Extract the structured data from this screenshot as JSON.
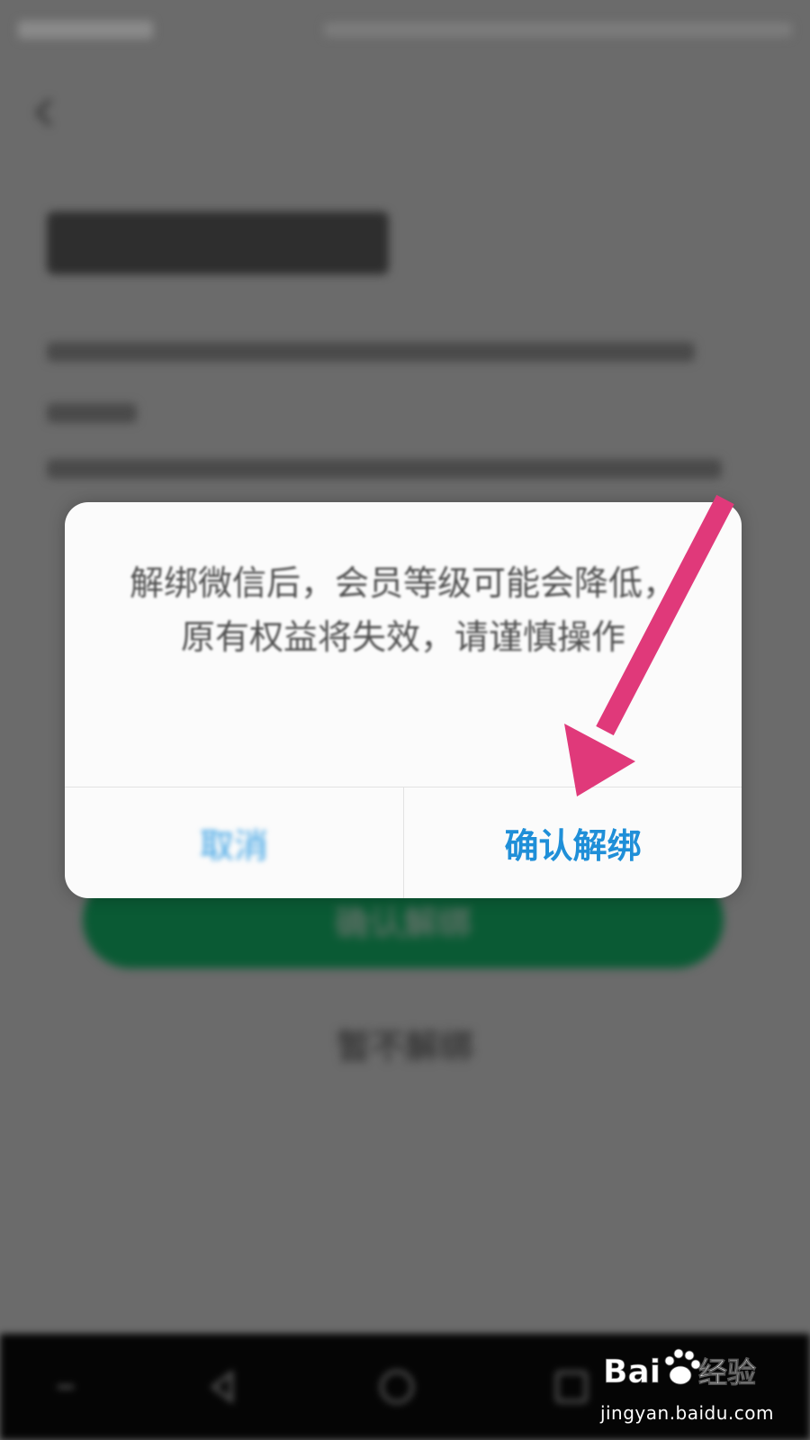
{
  "background": {
    "confirm_button_label": "确认解绑",
    "no_unbind_label": "暂不解绑"
  },
  "dialog": {
    "message": "解绑微信后，会员等级可能会降低，原有权益将失效，请谨慎操作",
    "cancel_label": "取消",
    "confirm_label": "确认解绑"
  },
  "watermark": {
    "brand": "Baidu经验",
    "url": "jingyan.baidu.com"
  },
  "colors": {
    "dialog_confirm": "#1f8fd8",
    "annotation_arrow": "#e0397a",
    "background_button": "#0a5a34"
  },
  "icons": [
    "back-icon",
    "nav-back-icon",
    "nav-home-icon",
    "nav-recent-icon",
    "nav-menu-icon"
  ]
}
